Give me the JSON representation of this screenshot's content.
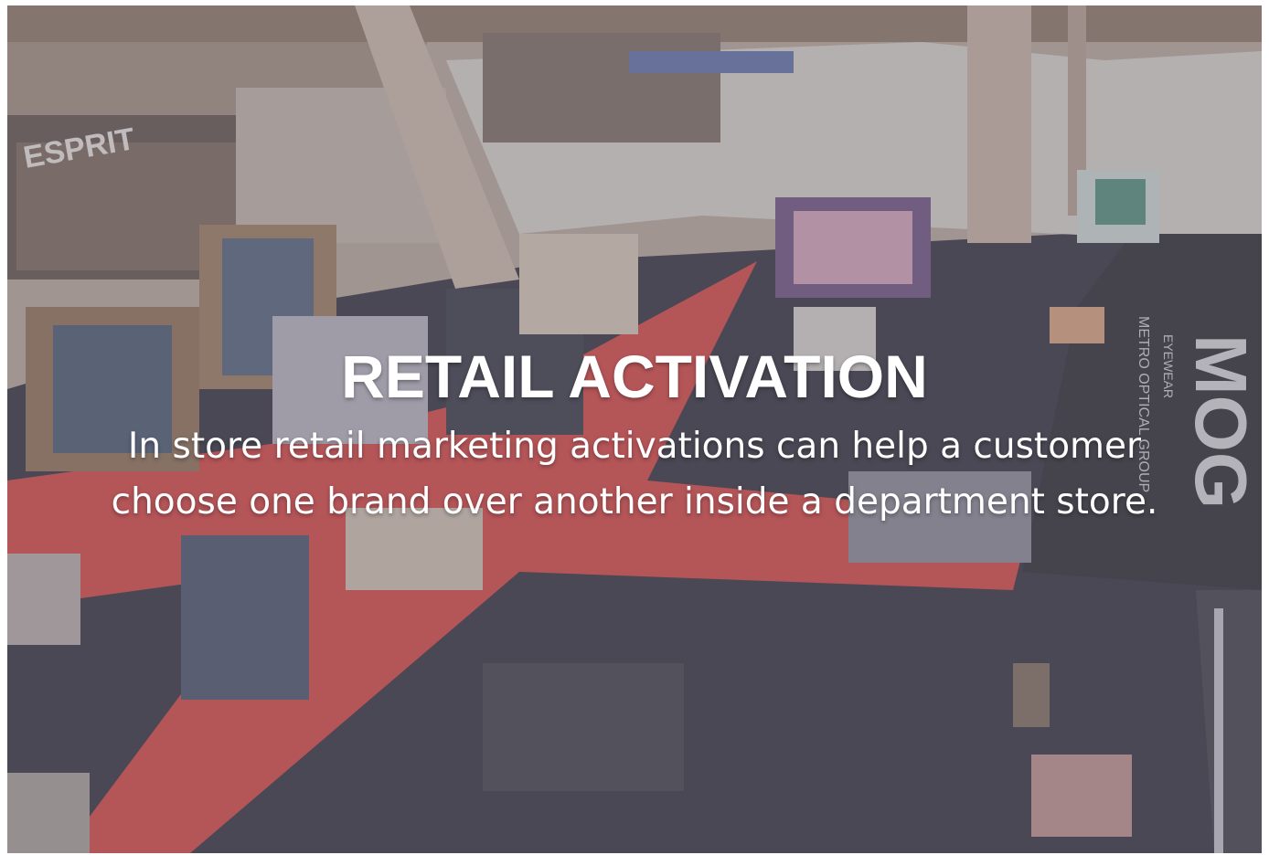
{
  "slide": {
    "title": "RETAIL ACTIVATION",
    "subtitle_line1": "In store retail marketing activations can help a customer",
    "subtitle_line2": "choose one brand over another inside a department store."
  },
  "photo": {
    "booth_logo": "MOG",
    "booth_sub1": "EYEWEAR",
    "booth_sub2": "METRO OPTICAL GROUP",
    "store_sign": "ESPRIT",
    "overlay_color": "#78768a",
    "carpet_red": "#d8413e",
    "carpet_dark": "#2d2c37"
  }
}
